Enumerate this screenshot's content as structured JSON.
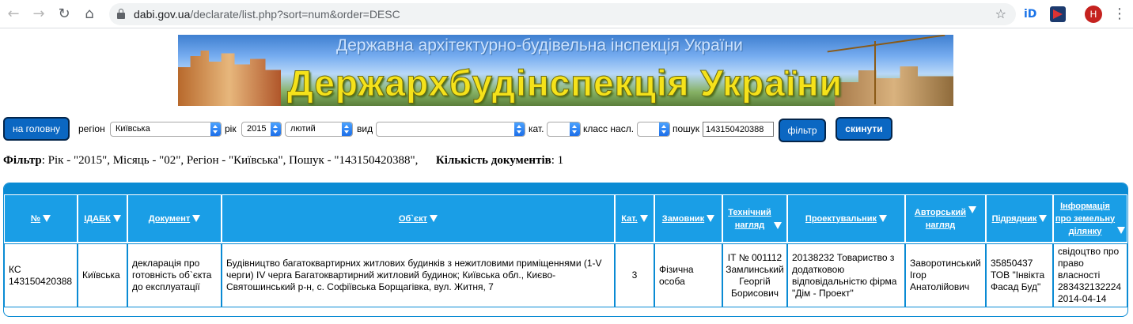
{
  "browser": {
    "url_host": "dabi.gov.ua",
    "url_path": "/declarate/list.php?sort=num&order=DESC",
    "avatar_letter": "H",
    "ext1_label": "iD"
  },
  "banner": {
    "subtitle": "Державна архітектурно-будівельна інспекція України",
    "title": "Держархбудінспекція України"
  },
  "filters": {
    "home_button": "на головну",
    "region_label": "регіон",
    "region_value": "Київська",
    "year_label": "рік",
    "year_value": "2015",
    "month_value": "лютий",
    "type_label": "вид",
    "type_value": "",
    "cat_label": "кат.",
    "cat_value": "",
    "class_label": "класс насл.",
    "class_value": "",
    "search_label": "пошук",
    "search_value": "143150420388",
    "filter_button": "фільтр",
    "reset_button": "скинути"
  },
  "summary": {
    "filter_label": "Фільтр",
    "filter_text": ": Рік - \"2015\", Місяць - \"02\", Регіон - \"Київська\", Пошук - \"143150420388\",",
    "count_label": "Кількість документів",
    "count_value": ": 1"
  },
  "table": {
    "headers": {
      "num": "№",
      "idabk": "ІДАБК",
      "document": "Документ",
      "object": "Об`єкт",
      "cat": "Кат.",
      "customer": "Замовник",
      "tech_1": "Технічний",
      "tech_2": "нагляд",
      "designer": "Проектувальник",
      "author_1": "Авторський",
      "author_2": "нагляд",
      "contractor": "Підрядник",
      "land_1": "Інформація",
      "land_2": "про земельну",
      "land_3": "ділянку"
    },
    "row": {
      "num_1": "КС",
      "num_2": "143150420388",
      "idabk": "Київська",
      "document": "декларація про готовність об`єкта до експлуатації",
      "object": "Будівництво багатоквартирних житлових будинків з нежитловими приміщеннями (1-V черги) IV черга Багатоквартирний житловий будинок; Київська обл., Києво-Святошинський р-н, с. Софіївська Борщагівка, вул. Житня, 7",
      "cat": "3",
      "customer": "Фізична особа",
      "tech": "ІТ № 001112 Замлинський Георгій Борисович",
      "designer": "20138232 Товариство з додатковою відповідальністю фірма \"Дім - Проект\"",
      "author": "Заворотинський Ігор Анатолійович",
      "contractor": "35850437 ТОВ \"Інвікта Фасад Буд\"",
      "land": "свідоцтво про право власності 283432132224 2014-04-14"
    }
  }
}
